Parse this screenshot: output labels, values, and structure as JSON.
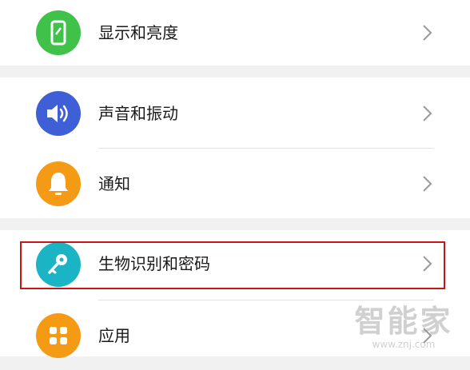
{
  "settings": {
    "items": [
      {
        "label": "显示和亮度",
        "icon": "phone-brightness-icon",
        "color": "#3fc14a"
      },
      {
        "label": "声音和振动",
        "icon": "speaker-icon",
        "color": "#3f5fd6"
      },
      {
        "label": "通知",
        "icon": "bell-icon",
        "color": "#f59a14"
      },
      {
        "label": "生物识别和密码",
        "icon": "key-icon",
        "color": "#1ab4c4"
      },
      {
        "label": "应用",
        "icon": "apps-grid-icon",
        "color": "#f59a14"
      }
    ]
  },
  "highlight": {
    "color": "#cc1414"
  },
  "watermark": {
    "brand": "智能家",
    "url": "www.znj.com"
  }
}
